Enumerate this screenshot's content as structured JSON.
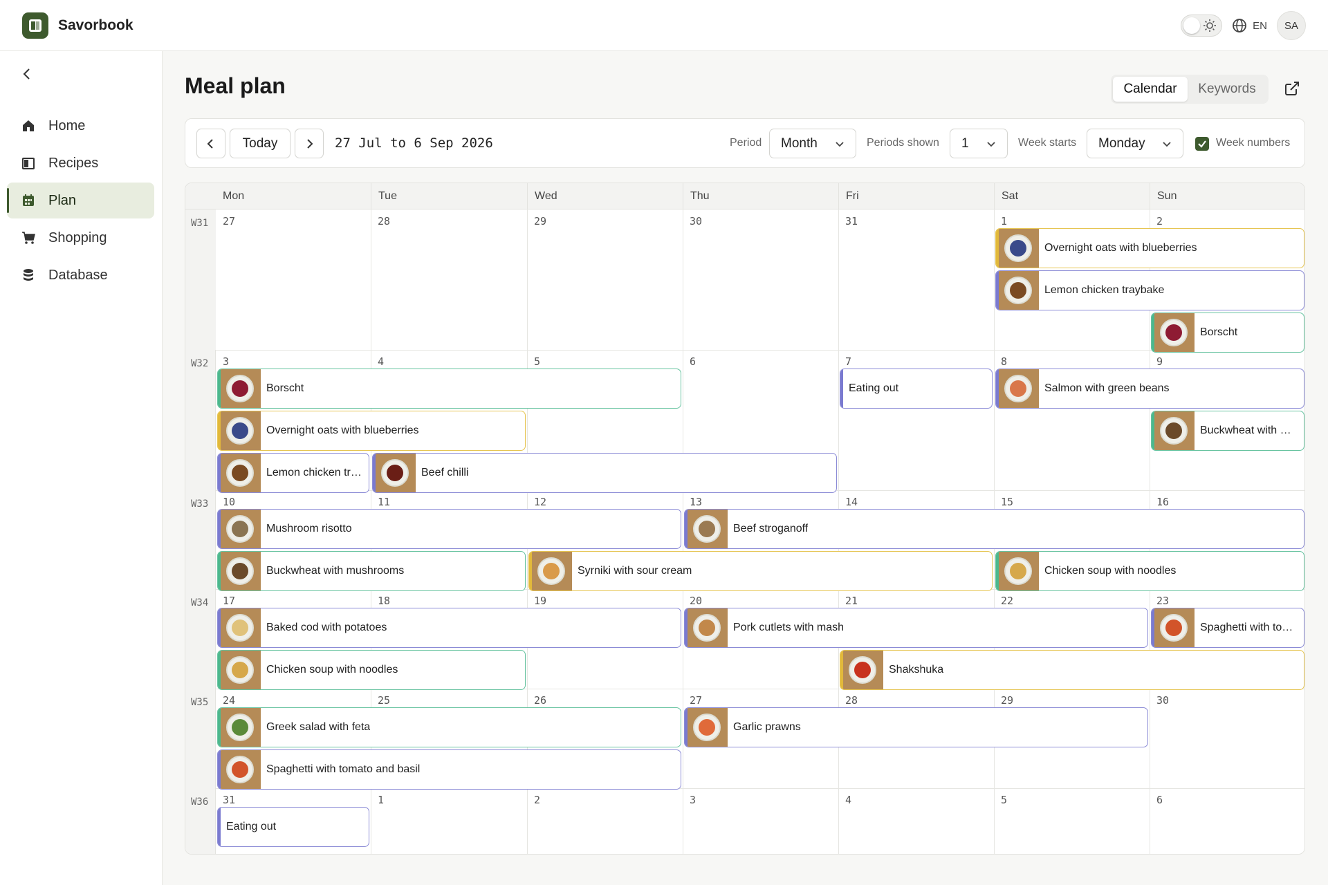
{
  "app": {
    "name": "Savorbook"
  },
  "topbar": {
    "language": "EN",
    "user_initials": "SA"
  },
  "sidebar": {
    "items": [
      {
        "label": "Home",
        "icon": "home-icon",
        "active": false
      },
      {
        "label": "Recipes",
        "icon": "book-icon",
        "active": false
      },
      {
        "label": "Plan",
        "icon": "calendar-icon",
        "active": true
      },
      {
        "label": "Shopping",
        "icon": "cart-icon",
        "active": false
      },
      {
        "label": "Database",
        "icon": "database-icon",
        "active": false
      }
    ]
  },
  "page": {
    "title": "Meal plan"
  },
  "view_toggle": {
    "calendar": "Calendar",
    "keywords": "Keywords"
  },
  "toolbar": {
    "today_label": "Today",
    "range": "27 Jul to 6 Sep 2026",
    "period_label": "Period",
    "period_value": "Month",
    "periods_shown_label": "Periods shown",
    "periods_shown_value": "1",
    "week_starts_label": "Week starts",
    "week_starts_value": "Monday",
    "week_numbers_label": "Week numbers",
    "week_numbers_checked": true
  },
  "calendar": {
    "days": [
      "Mon",
      "Tue",
      "Wed",
      "Thu",
      "Fri",
      "Sat",
      "Sun"
    ],
    "weeks": [
      {
        "label": "W31",
        "dates": [
          "27",
          "28",
          "29",
          "30",
          "31",
          "1",
          "2"
        ]
      },
      {
        "label": "W32",
        "dates": [
          "3",
          "4",
          "5",
          "6",
          "7",
          "8",
          "9"
        ]
      },
      {
        "label": "W33",
        "dates": [
          "10",
          "11",
          "12",
          "13",
          "14",
          "15",
          "16"
        ]
      },
      {
        "label": "W34",
        "dates": [
          "17",
          "18",
          "19",
          "20",
          "21",
          "22",
          "23"
        ]
      },
      {
        "label": "W35",
        "dates": [
          "24",
          "25",
          "26",
          "27",
          "28",
          "29",
          "30"
        ]
      },
      {
        "label": "W36",
        "dates": [
          "31",
          "1",
          "2",
          "3",
          "4",
          "5",
          "6"
        ]
      }
    ],
    "events": [
      {
        "week": 0,
        "start": 5,
        "end": 6,
        "row": 0,
        "title": "Overnight oats with blueberries",
        "color": "yellow",
        "image": true,
        "food": "#3a4a8a"
      },
      {
        "week": 0,
        "start": 5,
        "end": 6,
        "row": 1,
        "title": "Lemon chicken traybake",
        "color": "purple",
        "image": true,
        "food": "#7a4a22"
      },
      {
        "week": 0,
        "start": 6,
        "end": 6,
        "row": 2,
        "title": "Borscht",
        "color": "green",
        "image": true,
        "food": "#8e1b33"
      },
      {
        "week": 1,
        "start": 0,
        "end": 2,
        "row": 0,
        "title": "Borscht",
        "color": "green",
        "image": true,
        "food": "#8e1b33"
      },
      {
        "week": 1,
        "start": 4,
        "end": 4,
        "row": 0,
        "title": "Eating out",
        "color": "purple",
        "image": false
      },
      {
        "week": 1,
        "start": 5,
        "end": 6,
        "row": 0,
        "title": "Salmon with green beans",
        "color": "purple",
        "image": true,
        "food": "#d9774a"
      },
      {
        "week": 1,
        "start": 0,
        "end": 1,
        "row": 1,
        "title": "Overnight oats with blueberries",
        "color": "yellow",
        "image": true,
        "food": "#3a4a8a"
      },
      {
        "week": 1,
        "start": 6,
        "end": 6,
        "row": 1,
        "title": "Buckwheat with …",
        "color": "green",
        "image": true,
        "food": "#6b4a2a"
      },
      {
        "week": 1,
        "start": 0,
        "end": 0,
        "row": 2,
        "title": "Lemon chicken tr…",
        "color": "purple",
        "image": true,
        "food": "#7a4a22"
      },
      {
        "week": 1,
        "start": 1,
        "end": 3,
        "row": 2,
        "title": "Beef chilli",
        "color": "purple",
        "image": true,
        "food": "#6a1e16"
      },
      {
        "week": 2,
        "start": 0,
        "end": 2,
        "row": 0,
        "title": "Mushroom risotto",
        "color": "purple",
        "image": true,
        "food": "#8a7452"
      },
      {
        "week": 2,
        "start": 3,
        "end": 6,
        "row": 0,
        "title": "Beef stroganoff",
        "color": "purple",
        "image": true,
        "food": "#9a7a52"
      },
      {
        "week": 2,
        "start": 0,
        "end": 1,
        "row": 1,
        "title": "Buckwheat with mushrooms",
        "color": "green",
        "image": true,
        "food": "#6b4a2a"
      },
      {
        "week": 2,
        "start": 2,
        "end": 4,
        "row": 1,
        "title": "Syrniki with sour cream",
        "color": "yellow",
        "image": true,
        "food": "#d99a4a"
      },
      {
        "week": 2,
        "start": 5,
        "end": 6,
        "row": 1,
        "title": "Chicken soup with noodles",
        "color": "green",
        "image": true,
        "food": "#d6a84a"
      },
      {
        "week": 3,
        "start": 0,
        "end": 2,
        "row": 0,
        "title": "Baked cod with potatoes",
        "color": "purple",
        "image": true,
        "food": "#e0c27a"
      },
      {
        "week": 3,
        "start": 3,
        "end": 5,
        "row": 0,
        "title": "Pork cutlets with mash",
        "color": "purple",
        "image": true,
        "food": "#c2884a"
      },
      {
        "week": 3,
        "start": 6,
        "end": 6,
        "row": 0,
        "title": "Spaghetti with to…",
        "color": "purple",
        "image": true,
        "food": "#d2542a"
      },
      {
        "week": 3,
        "start": 0,
        "end": 1,
        "row": 1,
        "title": "Chicken soup with noodles",
        "color": "green",
        "image": true,
        "food": "#d6a84a"
      },
      {
        "week": 3,
        "start": 4,
        "end": 6,
        "row": 1,
        "title": "Shakshuka",
        "color": "yellow",
        "image": true,
        "food": "#c8321e"
      },
      {
        "week": 4,
        "start": 0,
        "end": 2,
        "row": 0,
        "title": "Greek salad with feta",
        "color": "green",
        "image": true,
        "food": "#5a8a3a"
      },
      {
        "week": 4,
        "start": 3,
        "end": 5,
        "row": 0,
        "title": "Garlic prawns",
        "color": "purple",
        "image": true,
        "food": "#e06a3a"
      },
      {
        "week": 4,
        "start": 0,
        "end": 2,
        "row": 1,
        "title": "Spaghetti with tomato and basil",
        "color": "purple",
        "image": true,
        "food": "#d2542a"
      },
      {
        "week": 5,
        "start": 0,
        "end": 0,
        "row": 0,
        "title": "Eating out",
        "color": "purple",
        "image": false
      }
    ]
  }
}
